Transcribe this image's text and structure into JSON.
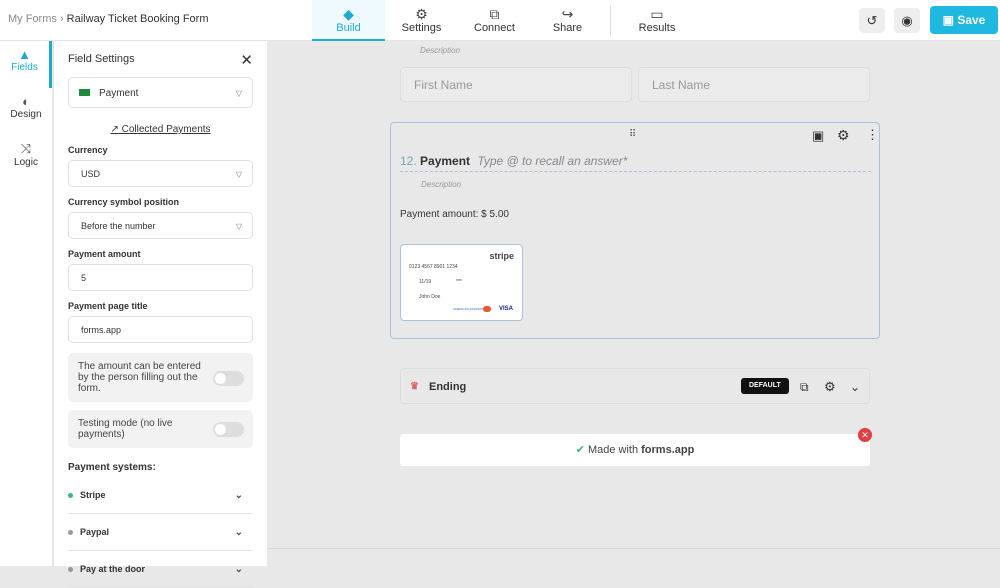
{
  "breadcrumb": {
    "root": "My Forms",
    "current": "Railway Ticket Booking Form"
  },
  "tabs": [
    {
      "label": "Build",
      "icon": "layers-icon"
    },
    {
      "label": "Settings",
      "icon": "gear-icon"
    },
    {
      "label": "Connect",
      "icon": "puzzle-icon"
    },
    {
      "label": "Share",
      "icon": "share-icon"
    },
    {
      "label": "Results",
      "icon": "inbox-icon"
    }
  ],
  "header": {
    "save": "Save"
  },
  "rail": [
    {
      "label": "Fields"
    },
    {
      "label": "Design"
    },
    {
      "label": "Logic"
    }
  ],
  "panel": {
    "title": "Field Settings",
    "field_type": "Payment",
    "collected": "Collected Payments",
    "currency_label": "Currency",
    "currency": "USD",
    "symbol_label": "Currency symbol position",
    "symbol": "Before the number",
    "amount_label": "Payment amount",
    "amount": "5",
    "page_title_label": "Payment page title",
    "page_title": "forms.app",
    "toggle1": "The amount can be entered by the person filling out the form.",
    "toggle1_on": false,
    "toggle2": "Testing mode (no live payments)",
    "toggle2_on": false,
    "systems_label": "Payment systems:",
    "systems": [
      {
        "name": "Stripe",
        "color": "#3cb878"
      },
      {
        "name": "Paypal",
        "color": "#999999"
      },
      {
        "name": "Pay at the door",
        "color": "#999999"
      }
    ]
  },
  "canvas": {
    "description_top": "Description",
    "first_name": "First Name",
    "last_name": "Last Name",
    "q_number": "12.",
    "q_title": "Payment",
    "q_placeholder": "Type @ to recall an answer*",
    "q_description": "Description",
    "payment_amount": "Payment amount: $ 5.00",
    "stripe": {
      "brand": "stripe",
      "number": "0123 4567 8901 1234",
      "exp": "11/19",
      "cvc": "***",
      "name": "John Doe",
      "amex": "AMERICAN EXPRESS",
      "visa": "VISA"
    },
    "ending": "Ending",
    "default_badge": "DEFAULT",
    "made_with": "Made with",
    "made_brand": "forms.app"
  }
}
